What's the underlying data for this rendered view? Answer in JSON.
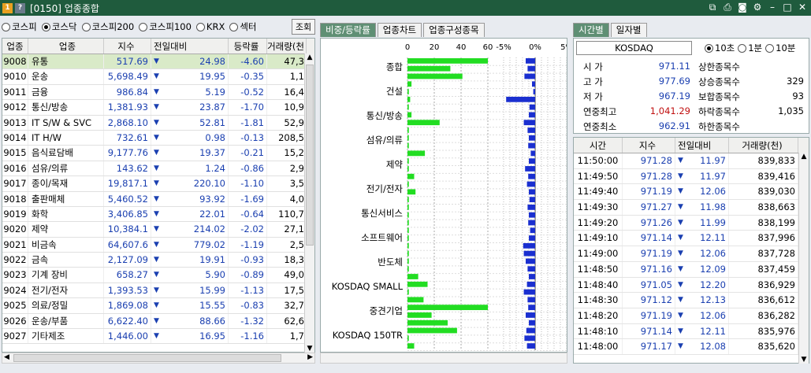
{
  "window": {
    "code": "[0150]",
    "title": "업종종합"
  },
  "market_radios": [
    {
      "label": "코스피",
      "on": false
    },
    {
      "label": "코스닥",
      "on": true
    },
    {
      "label": "코스피200",
      "on": false
    },
    {
      "label": "코스피100",
      "on": false
    },
    {
      "label": "KRX",
      "on": false
    },
    {
      "label": "섹터",
      "on": false
    }
  ],
  "query_label": "조회",
  "left_table": {
    "headers": [
      "업종",
      "업종",
      "지수",
      "전일대비",
      "등락률",
      "거래량(천"
    ],
    "rows": [
      [
        "9008",
        "유통",
        "517.69",
        "▼",
        "24.98",
        "-4.60",
        "47,3"
      ],
      [
        "9010",
        "운송",
        "5,698.49",
        "▼",
        "19.95",
        "-0.35",
        "1,1"
      ],
      [
        "9011",
        "금융",
        "986.84",
        "▼",
        "5.19",
        "-0.52",
        "16,4"
      ],
      [
        "9012",
        "통신/방송",
        "1,381.93",
        "▼",
        "23.87",
        "-1.70",
        "10,9"
      ],
      [
        "9013",
        "IT S/W & SVC",
        "2,868.10",
        "▼",
        "52.81",
        "-1.81",
        "52,9"
      ],
      [
        "9014",
        "IT H/W",
        "732.61",
        "▼",
        "0.98",
        "-0.13",
        "208,5"
      ],
      [
        "9015",
        "음식료담배",
        "9,177.76",
        "▼",
        "19.37",
        "-0.21",
        "15,2"
      ],
      [
        "9016",
        "섬유/의류",
        "143.62",
        "▼",
        "1.24",
        "-0.86",
        "2,9"
      ],
      [
        "9017",
        "종이/목재",
        "19,817.1",
        "▼",
        "220.10",
        "-1.10",
        "3,5"
      ],
      [
        "9018",
        "출판매체",
        "5,460.52",
        "▼",
        "93.92",
        "-1.69",
        "4,0"
      ],
      [
        "9019",
        "화학",
        "3,406.85",
        "▼",
        "22.01",
        "-0.64",
        "110,7"
      ],
      [
        "9020",
        "제약",
        "10,384.1",
        "▼",
        "214.02",
        "-2.02",
        "27,1"
      ],
      [
        "9021",
        "비금속",
        "64,607.6",
        "▼",
        "779.02",
        "-1.19",
        "2,5"
      ],
      [
        "9022",
        "금속",
        "2,127.09",
        "▼",
        "19.91",
        "-0.93",
        "18,3"
      ],
      [
        "9023",
        "기계 장비",
        "658.27",
        "▼",
        "5.90",
        "-0.89",
        "49,0"
      ],
      [
        "9024",
        "전기/전자",
        "1,393.53",
        "▼",
        "15.99",
        "-1.13",
        "17,5"
      ],
      [
        "9025",
        "의료/정밀",
        "1,869.08",
        "▼",
        "15.55",
        "-0.83",
        "32,7"
      ],
      [
        "9026",
        "운송/부품",
        "6,622.40",
        "▼",
        "88.66",
        "-1.32",
        "62,6"
      ],
      [
        "9027",
        "기타제조",
        "1,446.00",
        "▼",
        "16.95",
        "-1.16",
        "1,7"
      ]
    ]
  },
  "chart_tabs": [
    "비중/등락률",
    "업종차트",
    "업종구성종목"
  ],
  "chart_data": {
    "type": "bar",
    "axis_bar": {
      "ticks": [
        "0",
        "20",
        "40",
        "60"
      ],
      "range": [
        0,
        60
      ]
    },
    "axis_rate": {
      "ticks": [
        "-5%",
        "0%",
        "5%"
      ],
      "range": [
        -5,
        5
      ]
    },
    "category_labels": [
      "종합",
      "건설",
      "통신/방송",
      "섬유/의류",
      "제약",
      "전기/전자",
      "통신서비스",
      "소프트웨어",
      "반도체",
      "KOSDAQ SMALL",
      "중견기업",
      "KOSDAQ 150TR"
    ],
    "bars": [
      60,
      32,
      41,
      3,
      1,
      2,
      1,
      3,
      24,
      1,
      1,
      1,
      13,
      1,
      1,
      5,
      1,
      6,
      1,
      1,
      1,
      1,
      1,
      1,
      1,
      1,
      1,
      1,
      8,
      15,
      1,
      12,
      60,
      18,
      30,
      37,
      1,
      5
    ],
    "rates": [
      -1.5,
      -1.2,
      -1.7,
      -0.5,
      -0.3,
      -4.6,
      -0.9,
      -1.0,
      -1.8,
      -1.2,
      -1.0,
      -1.1,
      -0.7,
      -1.0,
      -1.6,
      -1.1,
      -1.3,
      -1.0,
      -0.9,
      -1.2,
      -1.0,
      -1.1,
      -0.8,
      -1.0,
      -1.9,
      -1.8,
      -1.5,
      -1.2,
      -1.0,
      -1.3,
      -1.8,
      -1.2,
      -1.1,
      -1.5,
      -1.0,
      -1.4,
      -1.7,
      -1.3
    ]
  },
  "right_tabs": [
    "시간별",
    "일자별"
  ],
  "index_name": "KOSDAQ",
  "interval_radios": [
    {
      "label": "10초",
      "on": true
    },
    {
      "label": "1분",
      "on": false
    },
    {
      "label": "10분",
      "on": false
    }
  ],
  "summary": [
    {
      "label": "시   가",
      "value": "971.11",
      "label2": "상한종목수",
      "value2": ""
    },
    {
      "label": "고   가",
      "value": "977.69",
      "label2": "상승종목수",
      "value2": "329"
    },
    {
      "label": "저   가",
      "value": "967.19",
      "label2": "보합종목수",
      "value2": "93"
    },
    {
      "label": "연중최고",
      "value": "1,041.29",
      "label2": "하락종목수",
      "value2": "1,035"
    },
    {
      "label": "연중최소",
      "value": "962.91",
      "label2": "하한종목수",
      "value2": ""
    }
  ],
  "right_table": {
    "headers": [
      "시간",
      "지수",
      "전일대비",
      "거래량(천)"
    ],
    "rows": [
      [
        "11:50:00",
        "971.28",
        "▼",
        "11.97",
        "839,833"
      ],
      [
        "11:49:50",
        "971.28",
        "▼",
        "11.97",
        "839,416"
      ],
      [
        "11:49:40",
        "971.19",
        "▼",
        "12.06",
        "839,030"
      ],
      [
        "11:49:30",
        "971.27",
        "▼",
        "11.98",
        "838,663"
      ],
      [
        "11:49:20",
        "971.26",
        "▼",
        "11.99",
        "838,199"
      ],
      [
        "11:49:10",
        "971.14",
        "▼",
        "12.11",
        "837,996"
      ],
      [
        "11:49:00",
        "971.19",
        "▼",
        "12.06",
        "837,728"
      ],
      [
        "11:48:50",
        "971.16",
        "▼",
        "12.09",
        "837,459"
      ],
      [
        "11:48:40",
        "971.05",
        "▼",
        "12.20",
        "836,929"
      ],
      [
        "11:48:30",
        "971.12",
        "▼",
        "12.13",
        "836,612"
      ],
      [
        "11:48:20",
        "971.19",
        "▼",
        "12.06",
        "836,282"
      ],
      [
        "11:48:10",
        "971.14",
        "▼",
        "12.11",
        "835,976"
      ],
      [
        "11:48:00",
        "971.17",
        "▼",
        "12.08",
        "835,620"
      ]
    ]
  },
  "colors": {
    "title_bg": "#1f5b3d",
    "bar": "#22dd22",
    "rate_bar": "#1a2fd0",
    "down": "#1a3fb0",
    "high": "#c01010"
  }
}
